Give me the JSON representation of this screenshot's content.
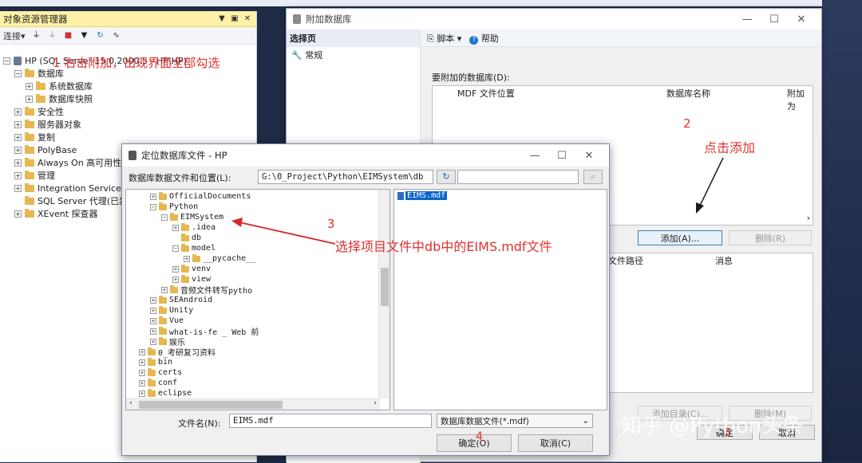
{
  "object_explorer": {
    "title": "对象资源管理器",
    "title_buttons": [
      "▼",
      "▣",
      "✕"
    ],
    "toolbar": {
      "connect": "连接",
      "connect_arrow": "▾"
    },
    "tree": [
      {
        "label": "HP (SQL Server 15.0.2000.5 - HP\\HP)",
        "expander": "⊟"
      },
      {
        "label": "数据库",
        "expander": "⊟"
      },
      {
        "label": "系统数据库",
        "expander": "⊞"
      },
      {
        "label": "数据库快照",
        "expander": "⊞"
      },
      {
        "label": "安全性",
        "expander": "⊞"
      },
      {
        "label": "服务器对象",
        "expander": "⊞"
      },
      {
        "label": "复制",
        "expander": "⊞"
      },
      {
        "label": "PolyBase",
        "expander": "⊞"
      },
      {
        "label": "Always On 高可用性",
        "expander": "⊞"
      },
      {
        "label": "管理",
        "expander": "⊞"
      },
      {
        "label": "Integration Services",
        "expander": "⊞"
      },
      {
        "label": "SQL Server 代理(已禁",
        "expander": ""
      },
      {
        "label": "XEvent 探查器",
        "expander": "⊞"
      }
    ]
  },
  "attach_window": {
    "title": "附加数据库",
    "select_page": "选择页",
    "pages": [
      "常规"
    ],
    "toolbar": {
      "script": "脚本",
      "help": "帮助"
    },
    "db_to_attach_label": "要附加的数据库(D):",
    "columns": [
      "MDF 文件位置",
      "数据库名称",
      "附加为"
    ],
    "add_button": "添加(A)...",
    "remove_button": "删除(R)",
    "details_columns": [
      "文件路径",
      "消息"
    ],
    "add_catalog_button": "添加目录(C)...",
    "remove_button2": "删除(M)",
    "ok_button": "确定",
    "cancel_button": "取消"
  },
  "locate_dialog": {
    "title": "定位数据库文件 - HP",
    "path_label": "数据库数据文件和位置(L):",
    "path_value": "G:\\0_Project\\Python\\EIMSystem\\db",
    "search_value": "",
    "tree": [
      {
        "label": "OfficialDocuments",
        "expander": "⊞"
      },
      {
        "label": "Python",
        "expander": "⊟"
      },
      {
        "label": "EIMSystem",
        "expander": "⊟"
      },
      {
        "label": ".idea",
        "expander": "⊞"
      },
      {
        "label": "db",
        "expander": ""
      },
      {
        "label": "model",
        "expander": "⊟"
      },
      {
        "label": "__pycache__",
        "expander": "⊞"
      },
      {
        "label": "venv",
        "expander": "⊞"
      },
      {
        "label": "view",
        "expander": "⊞"
      },
      {
        "label": "音频文件转写pytho",
        "expander": "⊞"
      },
      {
        "label": "SEAndroid",
        "expander": "⊞"
      },
      {
        "label": "Unity",
        "expander": "⊞"
      },
      {
        "label": "Vue",
        "expander": "⊞"
      },
      {
        "label": "what-is-fe _ Web 前",
        "expander": "⊞"
      },
      {
        "label": "娱乐",
        "expander": "⊞"
      },
      {
        "label": "0_考研复习资料",
        "expander": "⊞"
      },
      {
        "label": "bin",
        "expander": "⊞"
      },
      {
        "label": "certs",
        "expander": "⊞"
      },
      {
        "label": "conf",
        "expander": "⊞"
      },
      {
        "label": "eclipse",
        "expander": "⊞"
      }
    ],
    "selected_file": "EIMS.mdf",
    "filename_label": "文件名(N):",
    "filename_value": "EIMS.mdf",
    "filetype_value": "数据库数据文件(*.mdf)",
    "ok_button": "确定(O)",
    "cancel_button": "取消(C)"
  },
  "annotations": {
    "step1": "1 右击附加，出现界面全部勾选",
    "step2_num": "2",
    "step2_text": "点击添加",
    "step3_num": "3",
    "step3_text": "选择项目文件中db中的EIMS.mdf文件",
    "step4_num": "4",
    "step5_num": "5"
  },
  "watermark": "知乎 @Python头条",
  "colors": {
    "annotation_red": "#e0312f",
    "title_highlight": "#fff1a8",
    "selection_blue": "#0a64c8"
  }
}
